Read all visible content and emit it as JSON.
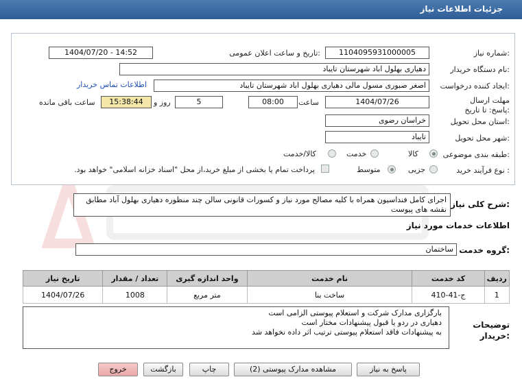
{
  "header": {
    "title": "جزئیات اطلاعات نیاز"
  },
  "form": {
    "need_number_label": "شماره نیاز:",
    "need_number": "1104095931000005",
    "announce_label": "تاریخ و ساعت اعلان عمومی:",
    "announce_value": "1404/07/20 - 14:52",
    "buyer_org_label": "نام دستگاه خریدار:",
    "buyer_org": "دهیاری بهلول اباد  شهرستان تایباد",
    "requester_label": "ایجاد کننده درخواست:",
    "requester": "اصغر صبوری مسول مالی دهیاری بهلول اباد  شهرستان تایباد",
    "contact_link": "اطلاعات تماس خریدار",
    "deadline_label": "مهلت ارسال پاسخ: تا تاریخ:",
    "deadline_date": "1404/07/26",
    "time_label": "ساعت",
    "deadline_time": "08:00",
    "days_value": "5",
    "days_label": "روز و",
    "remaining_time": "15:38:44",
    "remaining_label": "ساعت باقی مانده",
    "province_label": "استان محل تحویل:",
    "province": "خراسان رضوی",
    "city_label": "شهر محل تحویل:",
    "city": "تایباد",
    "category_label": "طبقه بندی موضوعی:",
    "category_options": [
      "کالا",
      "خدمت",
      "کالا/خدمت"
    ],
    "process_label": "نوع فرآیند خرید :",
    "process_options": [
      "جزیی",
      "متوسط"
    ],
    "payment_note": "پرداخت تمام یا بخشی از مبلغ خرید،از محل \"اسناد خزانه اسلامی\" خواهد بود."
  },
  "description": {
    "label": "شرح کلی نیاز:",
    "text": "اجرای کامل فنداسیون همراه با کلیه مصالح مورد نیاز و کسورات قانونی سالن چند منظوره دهیاری بهلول آباد مطابق نقشه های پیوست"
  },
  "services": {
    "section_title": "اطلاعات خدمات مورد نیاز",
    "group_label": "گروه خدمت:",
    "group_value": "ساختمان",
    "columns": [
      "ردیف",
      "کد خدمت",
      "نام خدمت",
      "واحد اندازه گیری",
      "تعداد / مقدار",
      "تاریخ نیاز"
    ],
    "rows": [
      {
        "row": "1",
        "code": "ج-41-410",
        "name": "ساخت بنا",
        "unit": "متر مربع",
        "qty": "1008",
        "date": "1404/07/26"
      }
    ]
  },
  "buyer_notes": {
    "label": "توضیحات خریدار:",
    "lines": [
      "بارگزاری مدارک شرکت و استعلام پیوستی الزامی است",
      "دهیاری در ردو یا قبول پیشنهادات مختار است",
      "به پیشنهادات فاقد استعلام پیوستی ترتیب اثر داده نخواهد شد"
    ]
  },
  "buttons": {
    "reply": "پاسخ به نیاز",
    "attachments": "مشاهده مدارک پیوستی (2)",
    "print": "چاپ",
    "back": "بازگشت",
    "exit": "خروج"
  },
  "colors": {
    "titlebar": "#3a6aa3",
    "remaining_bg": "#f3e6a8",
    "link": "#1f4fb4",
    "exit_bg": "#e8a8a8"
  }
}
